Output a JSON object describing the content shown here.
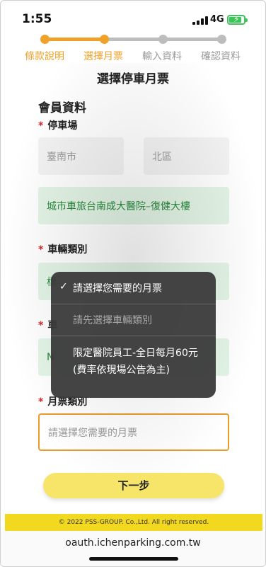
{
  "status_bar": {
    "time": "1:55",
    "network": "4G",
    "signal_icon": "signal-bars-icon",
    "battery_icon": "battery-charging-icon"
  },
  "stepper": {
    "steps": [
      {
        "label": "條款說明",
        "state": "done"
      },
      {
        "label": "選擇月票",
        "state": "active"
      },
      {
        "label": "輸入資料",
        "state": "pending"
      },
      {
        "label": "確認資料",
        "state": "pending"
      }
    ],
    "active_color": "#f0a12a",
    "inactive_color": "#bdbdbd"
  },
  "page": {
    "title": "選擇停車月票"
  },
  "member_section": {
    "title": "會員資料"
  },
  "form": {
    "parking_lot": {
      "label": "停車場",
      "required_mark": "*",
      "city": "臺南市",
      "district": "北區",
      "lot_name": "城市車旅台南成大醫院–復健大樓"
    },
    "vehicle_type": {
      "label": "車輛類別",
      "required_mark": "*",
      "value_prefix": "標",
      "value_partial": "標準車"
    },
    "plate": {
      "required_mark": "*",
      "label_partial": "車",
      "value_prefix": "N"
    },
    "monthly_ticket": {
      "label": "月票類別",
      "required_mark": "*",
      "placeholder": "請選擇您需要的月票"
    }
  },
  "dropdown": {
    "options": [
      {
        "label": "請選擇您需要的月票",
        "selected": true,
        "disabled": false
      },
      {
        "label": "請先選擇車輛類別",
        "selected": false,
        "disabled": true
      },
      {
        "label": "限定醫院員工-全日每月60元 (費率依現場公告為主)",
        "selected": false,
        "disabled": false
      }
    ],
    "check_icon": "checkmark-icon"
  },
  "buttons": {
    "next": "下一步"
  },
  "footer": {
    "copyright": "© 2022 PSS-GROUP. Co.,Ltd. All right reserved."
  },
  "browser": {
    "url": "oauth.ichenparking.com.tw"
  },
  "colors": {
    "accent": "#f0a12a",
    "button": "#f7e56a",
    "footer": "#f2d91f",
    "green_text": "#2b8a3e",
    "required": "#d9262c"
  }
}
